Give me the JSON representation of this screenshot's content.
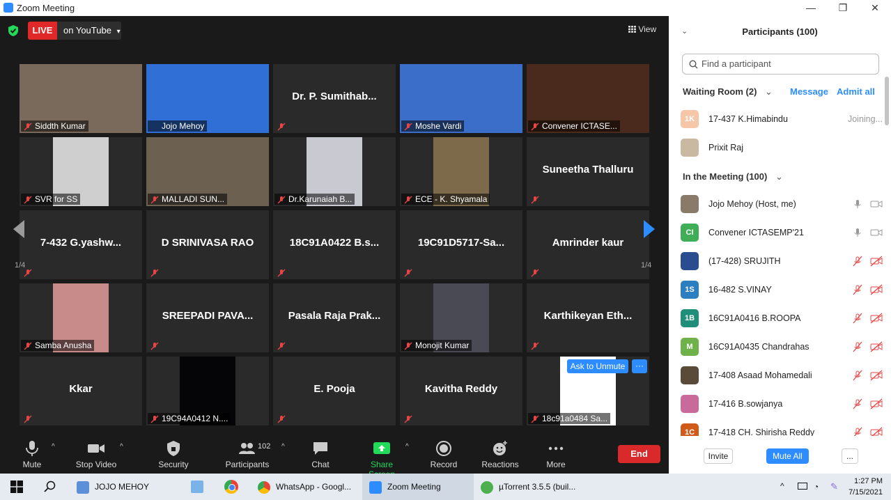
{
  "window": {
    "title": "Zoom Meeting",
    "controls": [
      "—",
      "❐",
      "✕"
    ]
  },
  "top": {
    "live": "LIVE",
    "stream": "on YouTube",
    "caret": "▾",
    "view": "View"
  },
  "tiles": [
    {
      "label": "Siddth Kumar",
      "type": "video",
      "bg": "#7a6a5c"
    },
    {
      "label": "Jojo Mehoy",
      "type": "video",
      "bg": "#2f6fd6"
    },
    {
      "name": "Dr. P. Sumithab...",
      "type": "name"
    },
    {
      "label": "Moshe Vardi",
      "type": "video",
      "bg": "#3a6ec8"
    },
    {
      "label": "Convener ICTASE...",
      "type": "video",
      "bg": "#4a2a1c"
    },
    {
      "label": "SVR for SS",
      "type": "video",
      "bg": "#cfcfcf"
    },
    {
      "label": "MALLADI SUN...",
      "type": "video",
      "bg": "#6c6050"
    },
    {
      "label": "Dr.Karunaiah B...",
      "type": "video",
      "bg": "#c9c9d2"
    },
    {
      "label": "ECE - K. Shyamala",
      "type": "video",
      "bg": "#7d6a4a"
    },
    {
      "name": "Suneetha Thalluru",
      "type": "name"
    },
    {
      "name": "7-432 G.yashw...",
      "type": "name"
    },
    {
      "name": "D SRINIVASA RAO",
      "type": "name"
    },
    {
      "name": "18C91A0422 B.s...",
      "type": "name"
    },
    {
      "name": "19C91D5717-Sa...",
      "type": "name"
    },
    {
      "name": "Amrinder kaur",
      "type": "name"
    },
    {
      "label": "Samba Anusha",
      "type": "video",
      "bg": "#c98a8a"
    },
    {
      "name": "SREEPADI PAVA...",
      "type": "name"
    },
    {
      "name": "Pasala Raja Prak...",
      "type": "name"
    },
    {
      "label": "Monojit Kumar",
      "type": "video",
      "bg": "#4a4a55"
    },
    {
      "name": "Karthikeyan Eth...",
      "type": "name"
    },
    {
      "name": "Kkar",
      "type": "name"
    },
    {
      "label": "19C94A0412 N....",
      "type": "video",
      "bg": "#050508"
    },
    {
      "name": "E. Pooja",
      "type": "name"
    },
    {
      "name": "Kavitha Reddy",
      "type": "name"
    },
    {
      "label": "18c91a0484 Sa...",
      "type": "video",
      "bg": "#ffffff"
    }
  ],
  "paging": {
    "left": "1/4",
    "right": "1/4"
  },
  "ask_unmute": {
    "label": "Ask to Unmute",
    "more": "···"
  },
  "toolbar": {
    "mute": "Mute",
    "stop_video": "Stop Video",
    "security": "Security",
    "participants": "Participants",
    "participants_count": "102",
    "chat": "Chat",
    "share_screen": "Share Screen",
    "record": "Record",
    "reactions": "Reactions",
    "more": "More",
    "end": "End"
  },
  "panel": {
    "title": "Participants (100)",
    "search_placeholder": "Find a participant",
    "waiting_room": "Waiting Room (2)",
    "message": "Message",
    "admit_all": "Admit all",
    "waiting": [
      {
        "initials": "1K",
        "name": "17-437 K.Himabindu",
        "status": "Joining...",
        "color": "#f5c7a8"
      },
      {
        "initials": "",
        "name": "Prixit Raj",
        "status": "",
        "color": "#c8b9a0"
      }
    ],
    "in_meeting": "In the Meeting (100)",
    "members": [
      {
        "initials": "",
        "name": "Jojo Mehoy (Host, me)",
        "color": "#8a7a6a",
        "muted": false
      },
      {
        "initials": "CI",
        "name": "Convener ICTASEMP'21",
        "color": "#3fae57",
        "muted": false
      },
      {
        "initials": "",
        "name": "(17-428) SRUJITH",
        "color": "#2a4d8f",
        "muted": true
      },
      {
        "initials": "1S",
        "name": "16-482 S.VINAY",
        "color": "#2b7fc1",
        "muted": true
      },
      {
        "initials": "1B",
        "name": "16C91A0416 B.ROOPA",
        "color": "#1f8f7a",
        "muted": true
      },
      {
        "initials": "M",
        "name": "16C91A0435 Chandrahas",
        "color": "#6fb24a",
        "muted": true
      },
      {
        "initials": "",
        "name": "17-408 Asaad Mohamedali",
        "color": "#5a4a3a",
        "muted": true
      },
      {
        "initials": "",
        "name": "17-416 B.sowjanya",
        "color": "#c86a9a",
        "muted": true
      },
      {
        "initials": "1C",
        "name": "17-418 CH. Shirisha Reddy",
        "color": "#d05a1a",
        "muted": true
      }
    ],
    "invite": "Invite",
    "mute_all": "Mute All",
    "more": "..."
  },
  "taskbar": {
    "items": [
      "JOJO MEHOY",
      "WhatsApp - Googl...",
      "Zoom Meeting",
      "µTorrent 3.5.5  (buil..."
    ],
    "time": "1:27 PM",
    "date": "7/15/2021"
  }
}
